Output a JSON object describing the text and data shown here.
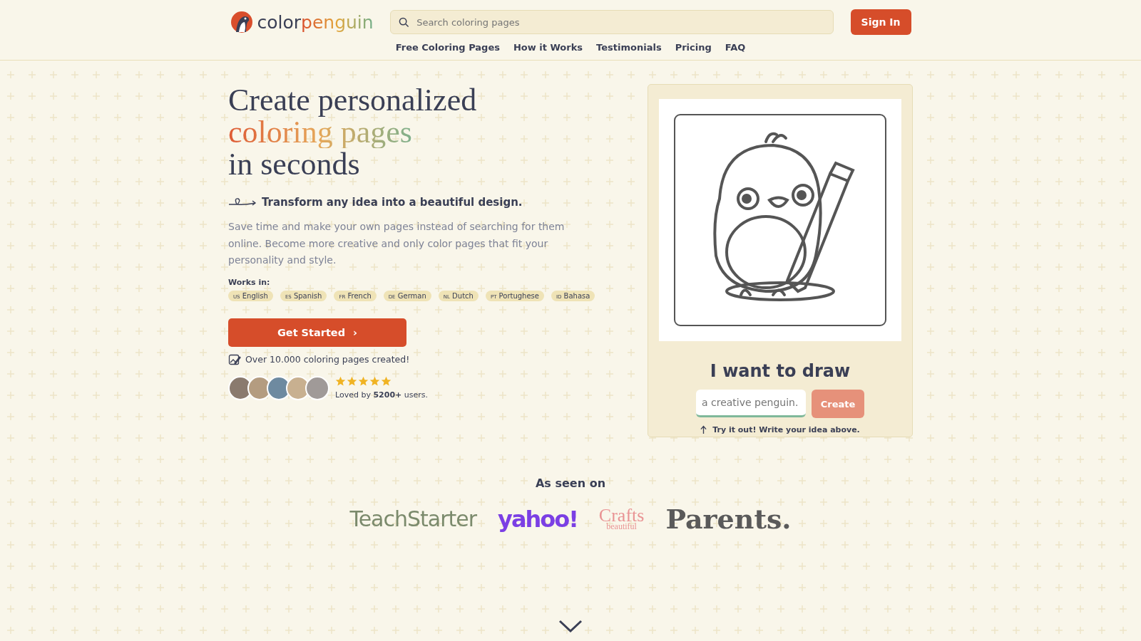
{
  "header": {
    "logo": {
      "first": "color",
      "second": "penguin"
    },
    "search": {
      "placeholder": "Search coloring pages"
    },
    "sign_in": "Sign In",
    "nav": [
      "Free Coloring Pages",
      "How it Works",
      "Testimonials",
      "Pricing",
      "FAQ"
    ]
  },
  "hero": {
    "headline": [
      {
        "text": "Create personalized",
        "kind": "plain"
      },
      {
        "text": "coloring pages",
        "kind": "colored"
      },
      {
        "text": "in seconds",
        "kind": "plain"
      }
    ],
    "tagline": "Transform any idea into a beautiful design.",
    "description": "Save time and make your own pages instead of searching for them online. Become more creative and only color pages that fit your personality and style.",
    "works_in_label": "Works in:",
    "languages": [
      {
        "code": "US",
        "name": "English"
      },
      {
        "code": "ES",
        "name": "Spanish"
      },
      {
        "code": "FR",
        "name": "French"
      },
      {
        "code": "DE",
        "name": "German"
      },
      {
        "code": "NL",
        "name": "Dutch"
      },
      {
        "code": "PT",
        "name": "Portughese"
      },
      {
        "code": "ID",
        "name": "Bahasa"
      }
    ],
    "cta": "Get Started",
    "cta_icon": "›",
    "created": "Over 10.000 coloring pages created!",
    "stars": 5,
    "loved": "Loved by **5200+** users."
  },
  "demo": {
    "title": "I want to draw",
    "input": {
      "placeholder": "a creative penguin."
    },
    "button": "Create",
    "hint": "Try it out! Write your idea above."
  },
  "press": {
    "title": "As seen on",
    "logos": [
      {
        "text": "TeachStarter",
        "kind": "teachstarter"
      },
      {
        "text": "yahoo!",
        "kind": "yahoo"
      },
      {
        "text": "Crafts",
        "sub": "beautiful",
        "kind": "crafts"
      },
      {
        "text": "Parents.",
        "kind": "parents"
      }
    ]
  }
}
